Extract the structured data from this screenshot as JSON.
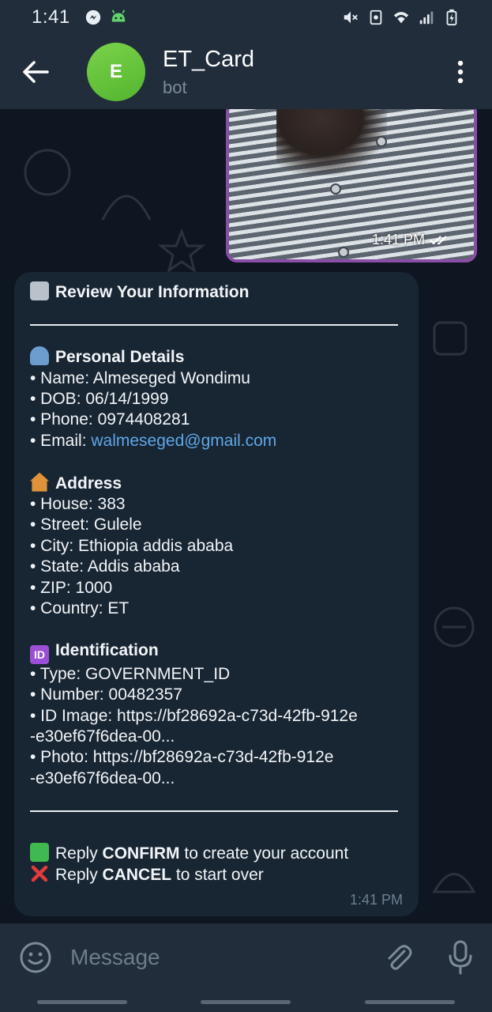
{
  "status_bar": {
    "time": "1:41",
    "left_icons": [
      "messenger-icon",
      "android-face-icon"
    ],
    "right_icons": [
      "mute-icon",
      "sim-icon",
      "wifi-icon",
      "signal-icon",
      "battery-icon"
    ]
  },
  "header": {
    "title": "ET_Card",
    "subtitle": "bot",
    "avatar_letter": "E",
    "avatar_color": "#5cbf36"
  },
  "photo_message": {
    "time": "1:41 PM",
    "status": "read"
  },
  "review_message": {
    "title": "Review Your Information",
    "personal_heading": "Personal Details",
    "name": "• Name: Almeseged Wondimu",
    "dob": "• DOB: 06/14/1999",
    "phone": "• Phone: 0974408281",
    "email_prefix": "• Email: ",
    "email": "walmeseged@gmail.com",
    "address_heading": "Address",
    "house": "• House: 383",
    "street": "• Street: Gulele",
    "city": "• City: Ethiopia addis ababa",
    "state": "• State: Addis ababa",
    "zip": "• ZIP: 1000",
    "country": "• Country: ET",
    "identification_heading": "Identification",
    "type": "• Type: GOVERNMENT_ID",
    "number": "• Number: 00482357",
    "id_image_line1": "• ID Image: https://bf28692a-c73d-42fb-912e",
    "id_image_line2": "-e30ef67f6dea-00...",
    "photo_line1": "• Photo: https://bf28692a-c73d-42fb-912e",
    "photo_line2": "-e30ef67f6dea-00...",
    "confirm_prefix": "Reply ",
    "confirm_word": "CONFIRM",
    "confirm_suffix": " to create your account",
    "cancel_prefix": "Reply ",
    "cancel_word": "CANCEL",
    "cancel_suffix": " to start over",
    "time": "1:41 PM"
  },
  "input": {
    "placeholder": "Message"
  },
  "colors": {
    "accent_link": "#5fa8e8",
    "bubble": "#182533",
    "header": "#212d3b",
    "photo_border": "#8a4ea8"
  }
}
